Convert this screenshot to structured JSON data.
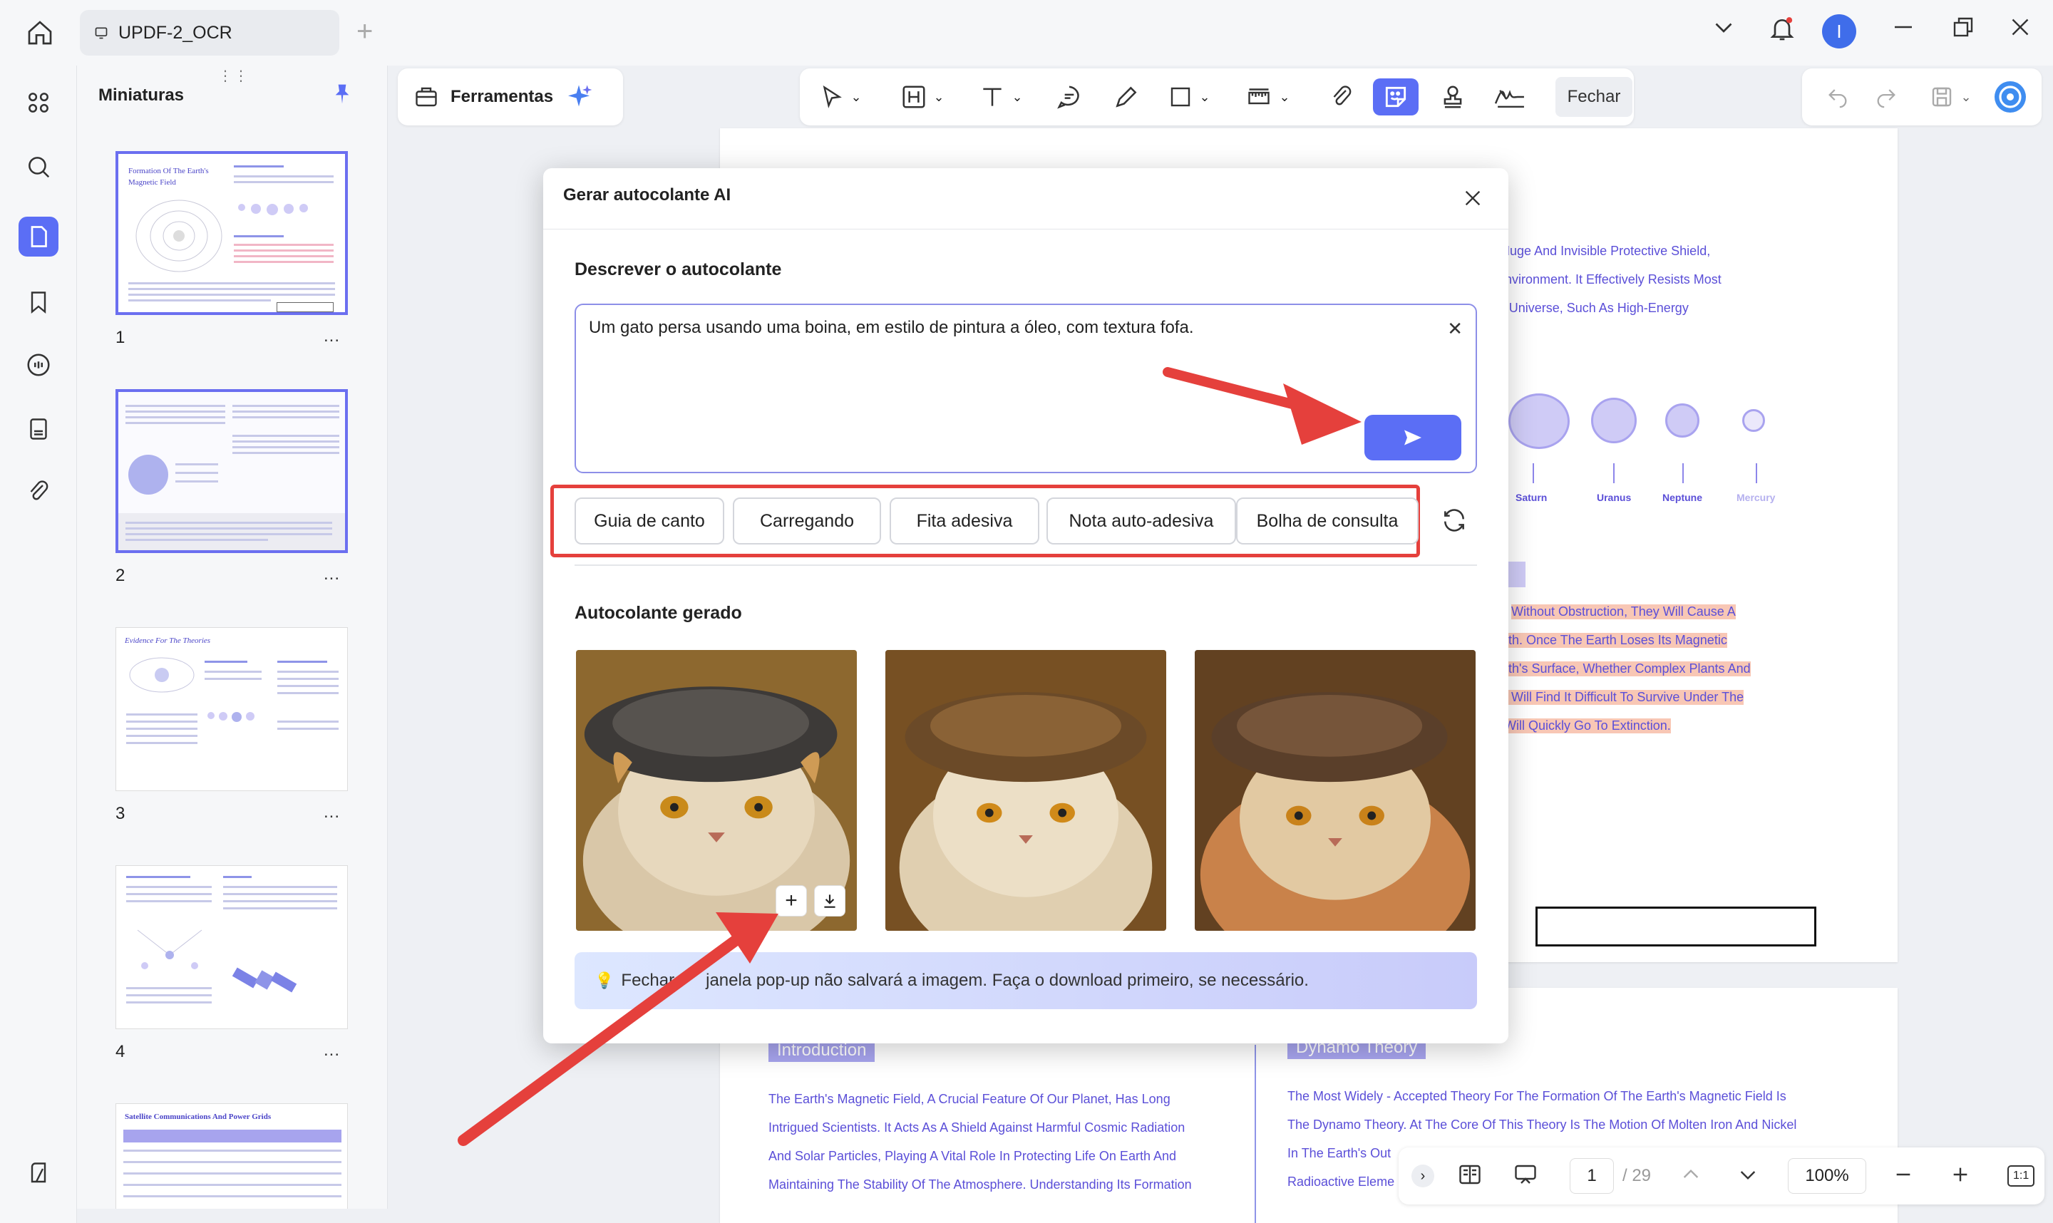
{
  "titlebar": {
    "doc_tab": "UPDF-2_OCR",
    "avatar_initial": "I"
  },
  "thumbnails": {
    "title": "Miniaturas",
    "pages": [
      {
        "number": "1",
        "title": "Formation Of The Earth's Magnetic Field"
      },
      {
        "number": "2",
        "title": ""
      },
      {
        "number": "3",
        "title": "Evidence For The Theories"
      },
      {
        "number": "4",
        "title": ""
      },
      {
        "number": "",
        "title": "Satellite Communications And Power Grids"
      }
    ],
    "more": "..."
  },
  "toolbar": {
    "tools_label": "Ferramentas",
    "close_label": "Fechar"
  },
  "document": {
    "page1_lines": [
      "ke A Huge And Invisible Protective Shield,",
      "mic Environment. It Effectively Resists Most",
      "n The Universe, Such As High-Energy"
    ],
    "planets": [
      "Saturn",
      "Uranus",
      "Neptune",
      "Mercury"
    ],
    "page1_hl_lines": [
      "Without Obstruction, They Will Cause A",
      "rth. Once The Earth Loses Its Magnetic",
      "rth's Surface, Whether Complex Plants And",
      ", Will Find It Difficult To Survive Under The",
      "Will Quickly Go To Extinction."
    ],
    "page2_heading_left": "Introduction",
    "page2_heading_right": "Dynamo Theory",
    "page2_left_lines": [
      "The Earth's Magnetic Field, A Crucial Feature Of Our Planet, Has Long",
      "Intrigued Scientists. It Acts As A Shield Against Harmful Cosmic Radiation",
      "And Solar Particles, Playing A Vital Role In Protecting Life On Earth And",
      "Maintaining The Stability Of The Atmosphere. Understanding Its Formation"
    ],
    "page2_right_lines": [
      "The Most Widely - Accepted Theory For The Formation Of The Earth's Magnetic Field Is",
      "The Dynamo Theory. At The Core Of This Theory Is The Motion Of Molten Iron And Nickel",
      "In The Earth's Out",
      "Radioactive Eleme"
    ]
  },
  "dialog": {
    "title": "Gerar autocolante AI",
    "describe_label": "Descrever o autocolante",
    "prompt_value": "Um gato persa usando uma boina, em estilo de pintura a óleo, com textura fofa.",
    "chips": [
      "Guia de canto",
      "Carregando",
      "Fita adesiva",
      "Nota auto-adesiva",
      "Bolha de consulta"
    ],
    "generated_label": "Autocolante gerado",
    "image_add": "+",
    "info_before": "Fechar",
    "info_after": "janela pop-up não salvará a imagem. Faça o download primeiro, se necessário."
  },
  "bottom_nav": {
    "page_current": "1",
    "page_total": "/ 29",
    "zoom": "100%",
    "fit_label": "1:1"
  },
  "colors": {
    "accent": "#5b6ef5",
    "annotation_red": "#e5403c",
    "doc_text": "#5b4fd8"
  }
}
